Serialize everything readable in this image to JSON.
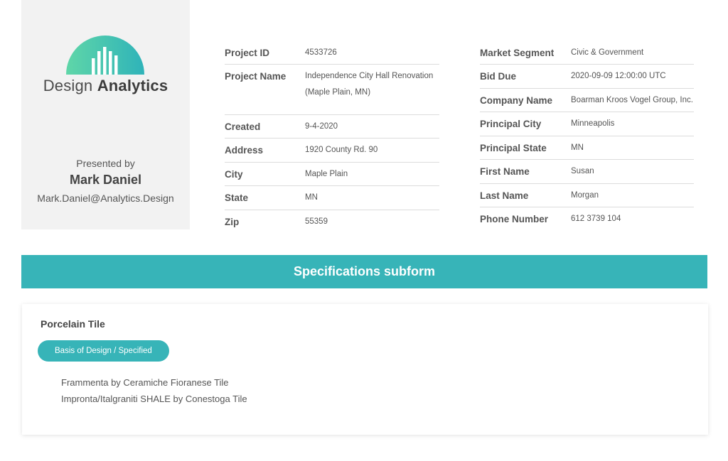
{
  "brand": {
    "logo_light": "Design",
    "logo_bold": "Analytics",
    "presented_by": "Presented by",
    "presenter_name": "Mark Daniel",
    "presenter_email": "Mark.Daniel@Analytics.Design",
    "colors": {
      "accent": "#37b4b8",
      "logo_gradient_start": "#5fd6a8",
      "logo_gradient_end": "#2fb3b9"
    }
  },
  "project_info": [
    {
      "label": "Project ID",
      "value": "4533726"
    },
    {
      "label": "Project Name",
      "value": "Independence City Hall Renovation (Maple Plain, MN)"
    },
    {
      "label": "Created",
      "value": "9-4-2020"
    },
    {
      "label": "Address",
      "value": "1920 County Rd. 90"
    },
    {
      "label": "City",
      "value": "Maple Plain"
    },
    {
      "label": "State",
      "value": "MN"
    },
    {
      "label": "Zip",
      "value": "55359"
    }
  ],
  "company_info": [
    {
      "label": "Market Segment",
      "value": "Civic & Government"
    },
    {
      "label": "Bid Due",
      "value": "2020-09-09 12:00:00 UTC"
    },
    {
      "label": "Company Name",
      "value": "Boarman Kroos Vogel Group, Inc."
    },
    {
      "label": "Principal City",
      "value": "Minneapolis"
    },
    {
      "label": "Principal State",
      "value": "MN"
    },
    {
      "label": "First Name",
      "value": "Susan"
    },
    {
      "label": "Last Name",
      "value": "Morgan"
    },
    {
      "label": "Phone Number",
      "value": "612 3739 104"
    }
  ],
  "specifications": {
    "title": "Specifications subform",
    "product_title": "Porcelain Tile",
    "basis_button": "Basis of Design / Specified",
    "items": [
      "Frammenta by Ceramiche Fioranese Tile",
      "Impronta/Italgraniti SHALE by Conestoga Tile"
    ]
  }
}
